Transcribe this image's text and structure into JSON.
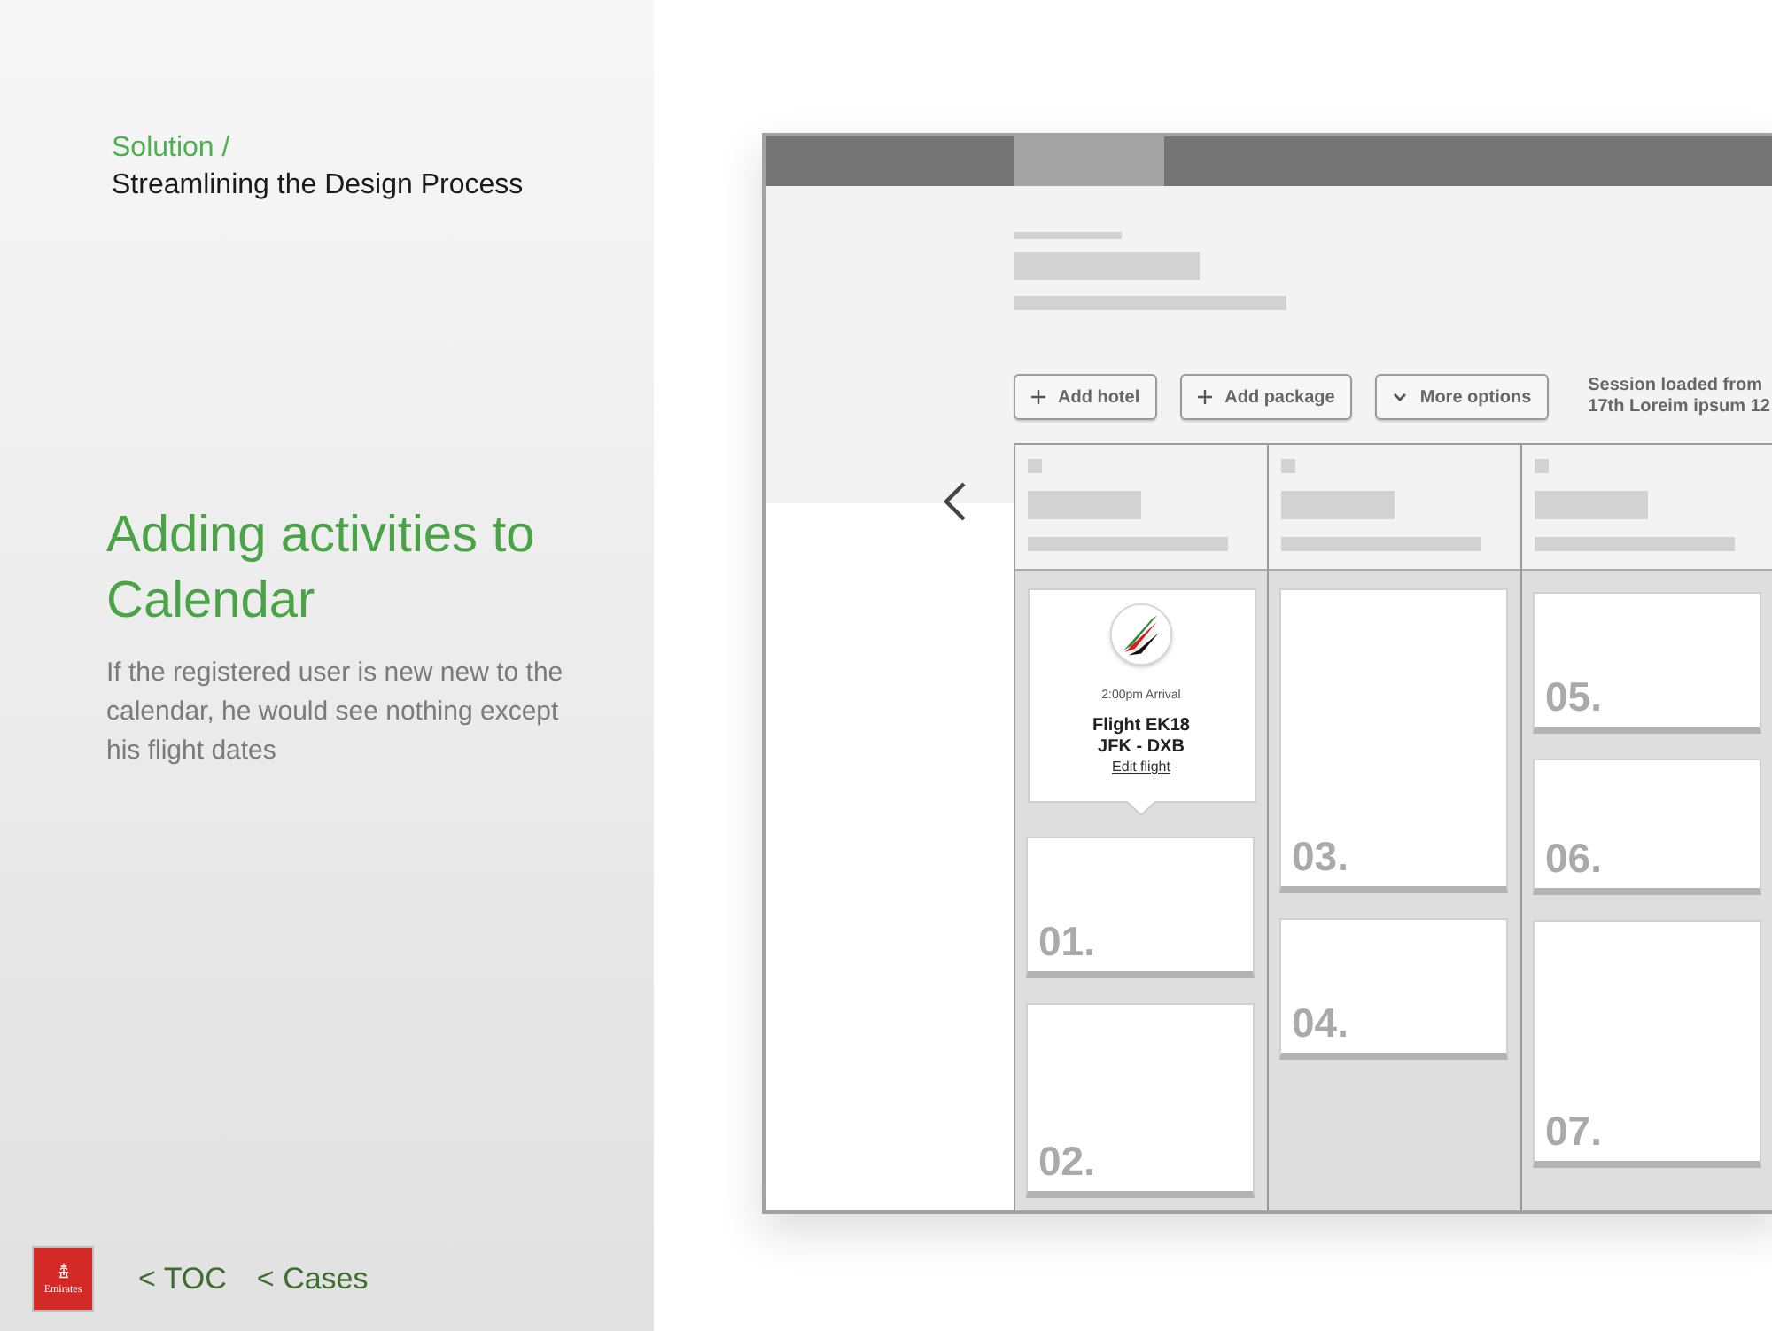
{
  "breadcrumb": {
    "section": "Solution /",
    "title": "Streamlining the Design Process"
  },
  "heading": "Adding activities to Calendar",
  "description": "If the registered user is new new to the calendar, he would see nothing except his flight dates",
  "footer": {
    "logo_text": "Emirates",
    "links": [
      "< TOC",
      "< Cases"
    ]
  },
  "mockup": {
    "buttons": [
      {
        "kind": "add",
        "label": "Add hotel"
      },
      {
        "kind": "add",
        "label": "Add package"
      },
      {
        "kind": "dropdown",
        "label": "More options"
      }
    ],
    "session_note": [
      "Session loaded from",
      "17th Loreim ipsum 12"
    ],
    "columns": [
      {
        "cards": [
          {
            "kind": "flight",
            "time": "2:00pm Arrival",
            "flight": "Flight EK18",
            "route": "JFK - DXB",
            "link": "Edit flight"
          },
          {
            "kind": "slot",
            "number": "01."
          },
          {
            "kind": "slot",
            "number": "02."
          }
        ]
      },
      {
        "cards": [
          {
            "kind": "slot",
            "number": "03."
          },
          {
            "kind": "slot",
            "number": "04."
          }
        ]
      },
      {
        "cards": [
          {
            "kind": "slot",
            "number": "05."
          },
          {
            "kind": "slot",
            "number": "06."
          },
          {
            "kind": "slot",
            "number": "07."
          }
        ]
      }
    ]
  }
}
